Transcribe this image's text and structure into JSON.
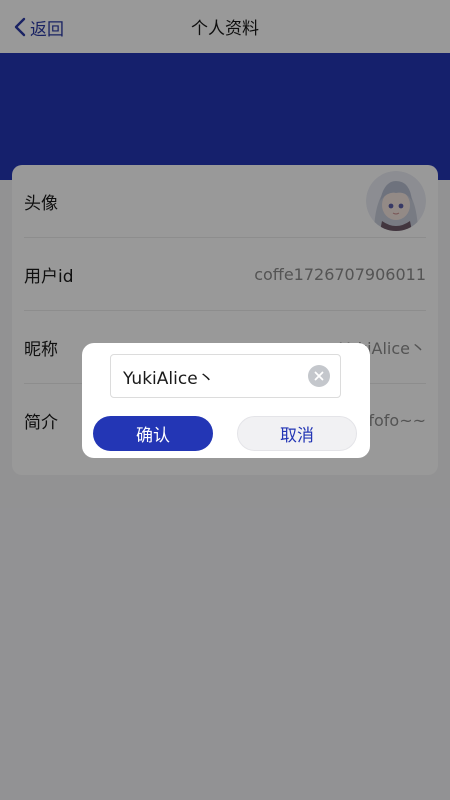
{
  "nav": {
    "back_label": "返回",
    "title": "个人资料"
  },
  "profile": {
    "avatar_label": "头像",
    "user_id_label": "用户id",
    "user_id_value": "coffe1726707906011",
    "nickname_label": "昵称",
    "nickname_value": "YukiAlice丶",
    "bio_label": "简介",
    "bio_value": "fofofo~~"
  },
  "dialog": {
    "input_value": "YukiAlice丶",
    "confirm_label": "确认",
    "cancel_label": "取消"
  },
  "colors": {
    "accent": "#2336b5",
    "overlay": "rgba(0,0,0,0.4)"
  }
}
